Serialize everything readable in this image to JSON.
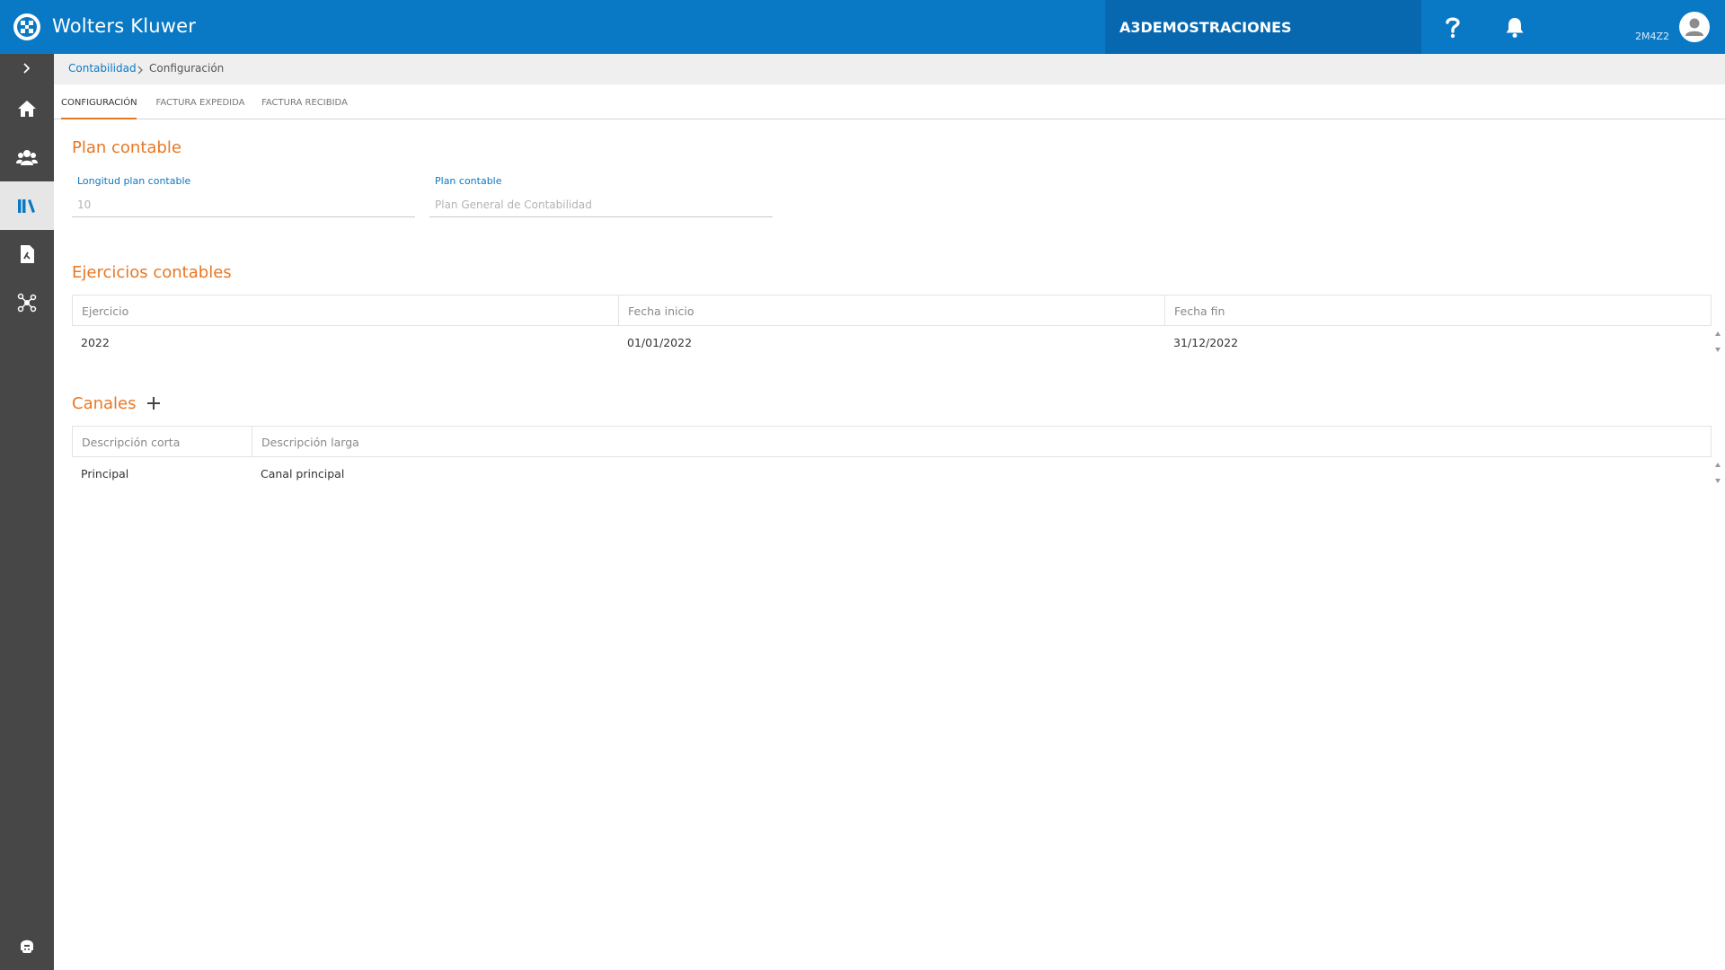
{
  "header": {
    "brand": "Wolters Kluwer",
    "company": "A3DEMOSTRACIONES",
    "user_code": "2M4Z2",
    "brand_color": "#0a79c5"
  },
  "sidebar": {
    "items": [
      {
        "icon": "chevron-right-icon",
        "active": false
      },
      {
        "icon": "home-icon",
        "active": false
      },
      {
        "icon": "users-icon",
        "active": false
      },
      {
        "icon": "books-icon",
        "active": true
      },
      {
        "icon": "document-icon",
        "active": false
      },
      {
        "icon": "network-icon",
        "active": false
      }
    ],
    "bottom_icon": "support-icon"
  },
  "breadcrumb": {
    "parent": "Contabilidad",
    "current": "Configuración"
  },
  "tabs": [
    {
      "label": "CONFIGURACIÓN",
      "active": true
    },
    {
      "label": "FACTURA EXPEDIDA",
      "active": false
    },
    {
      "label": "FACTURA RECIBIDA",
      "active": false
    }
  ],
  "plan_contable": {
    "title": "Plan contable",
    "longitud_label": "Longitud plan contable",
    "longitud_value": "10",
    "plan_label": "Plan contable",
    "plan_value": "Plan General de Contabilidad"
  },
  "ejercicios": {
    "title": "Ejercicios contables",
    "columns": [
      "Ejercicio",
      "Fecha inicio",
      "Fecha fin"
    ],
    "rows": [
      [
        "2022",
        "01/01/2022",
        "31/12/2022"
      ]
    ]
  },
  "canales": {
    "title": "Canales",
    "columns": [
      "Descripción corta",
      "Descripción larga"
    ],
    "rows": [
      [
        "Principal",
        "Canal principal"
      ]
    ]
  },
  "accent_color": "#e87722"
}
